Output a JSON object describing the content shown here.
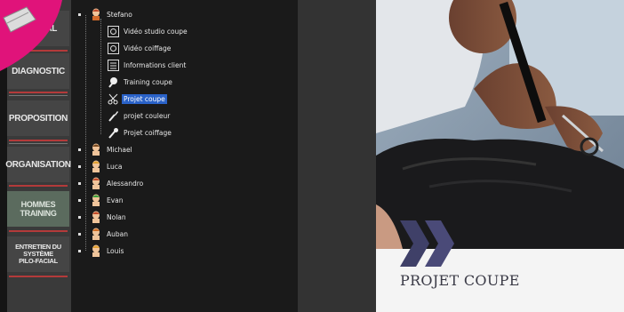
{
  "nav": {
    "items": [
      {
        "label": "ICAL"
      },
      {
        "label": "DIAGNOSTIC"
      },
      {
        "label": "PROPOSITION"
      },
      {
        "label": "ORGANISATION"
      },
      {
        "label": "HOMMES TRAINING"
      },
      {
        "label": "ENTRETIEN DU SYSTÈME PILO-FACIAL"
      }
    ],
    "accent": "#b33a3a"
  },
  "tree": {
    "root": "Stefano",
    "children": [
      {
        "label": "Vidéo studio coupe",
        "icon": "video-icon"
      },
      {
        "label": "Vidéo coiffage",
        "icon": "video-icon"
      },
      {
        "label": "Informations client",
        "icon": "client-info-icon"
      },
      {
        "label": "Training coupe",
        "icon": "training-icon"
      },
      {
        "label": "Projet coupe",
        "icon": "scissors-icon",
        "selected": true
      },
      {
        "label": "projet couleur",
        "icon": "brush-icon"
      },
      {
        "label": "Projet coiffage",
        "icon": "comb-icon"
      }
    ],
    "people": [
      "Michael",
      "Luca",
      "Alessandro",
      "Evan",
      "Nolan",
      "Auban",
      "Louis"
    ],
    "selection_color": "#2a62c8"
  },
  "photo": {
    "title": "PROJET COUPE",
    "chevron_color": "#4a4a70"
  }
}
